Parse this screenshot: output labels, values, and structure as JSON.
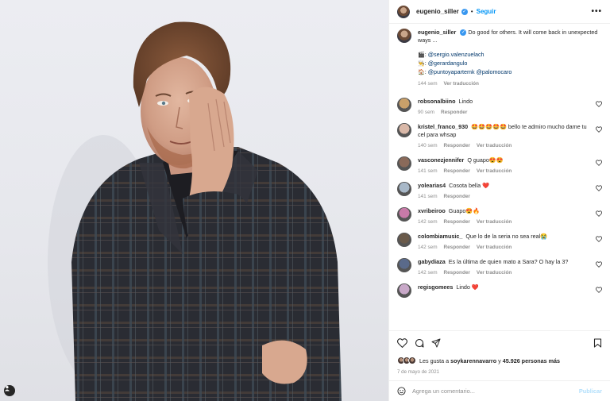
{
  "header": {
    "username": "eugenio_siller",
    "separator": "•",
    "follow_label": "Seguir",
    "more_label": "•••"
  },
  "caption": {
    "username": "eugenio_siller",
    "text": "Do good for others. It will come back in unexpected ways ...",
    "credits": [
      {
        "emoji": "🎬",
        "text": "@sergio.valenzuelach"
      },
      {
        "emoji": "👨‍🍳",
        "text": "@gerardangulo"
      },
      {
        "emoji": "🏠",
        "text": "@puntoyapartemk @palomocaro"
      }
    ],
    "time": "144 sem",
    "translate": "Ver traducción"
  },
  "comments": [
    {
      "user": "robsonalbiino",
      "text": "Lindo",
      "time": "90 sem",
      "reply": "Responder",
      "translate": ""
    },
    {
      "user": "kristel_franco_930",
      "text": "🤩🤩🤩🤩🤩 bello te admiro mucho dame tu cel para whsap",
      "time": "140 sem",
      "reply": "Responder",
      "translate": "Ver traducción"
    },
    {
      "user": "vasconezjennifer",
      "text": "Q guapo😍😍",
      "time": "141 sem",
      "reply": "Responder",
      "translate": "Ver traducción"
    },
    {
      "user": "yolearias4",
      "text": "Cosota bella ❤️",
      "time": "141 sem",
      "reply": "Responder",
      "translate": ""
    },
    {
      "user": "xvribeiroo",
      "text": "Guapo😍🔥",
      "time": "142 sem",
      "reply": "Responder",
      "translate": "Ver traducción"
    },
    {
      "user": "colombiamusic_",
      "text": "Que lo de la seria no sea real😭",
      "time": "142 sem",
      "reply": "Responder",
      "translate": "Ver traducción"
    },
    {
      "user": "gabydiaza",
      "text": "Es la última de quien mato a Sara? O hay la 3?",
      "time": "142 sem",
      "reply": "Responder",
      "translate": "Ver traducción"
    },
    {
      "user": "regisgomees",
      "text": "Lindo ❤️",
      "time": "",
      "reply": "",
      "translate": ""
    }
  ],
  "likes": {
    "prefix": "Les gusta a",
    "user": "soykarennavarro",
    "mid": "y",
    "count": "45.926 personas más"
  },
  "date": "7 de mayo de 2021",
  "add_comment": {
    "placeholder": "Agrega un comentario...",
    "publish": "Publicar"
  },
  "colors": {
    "accent": "#0095f6",
    "publish_disabled": "#b2dffc",
    "muted": "#8e8e8e",
    "text": "#262626"
  },
  "icons": [
    "heart-icon",
    "comment-icon",
    "share-icon",
    "bookmark-icon",
    "emoji-icon",
    "user-tag-icon",
    "more-icon"
  ]
}
